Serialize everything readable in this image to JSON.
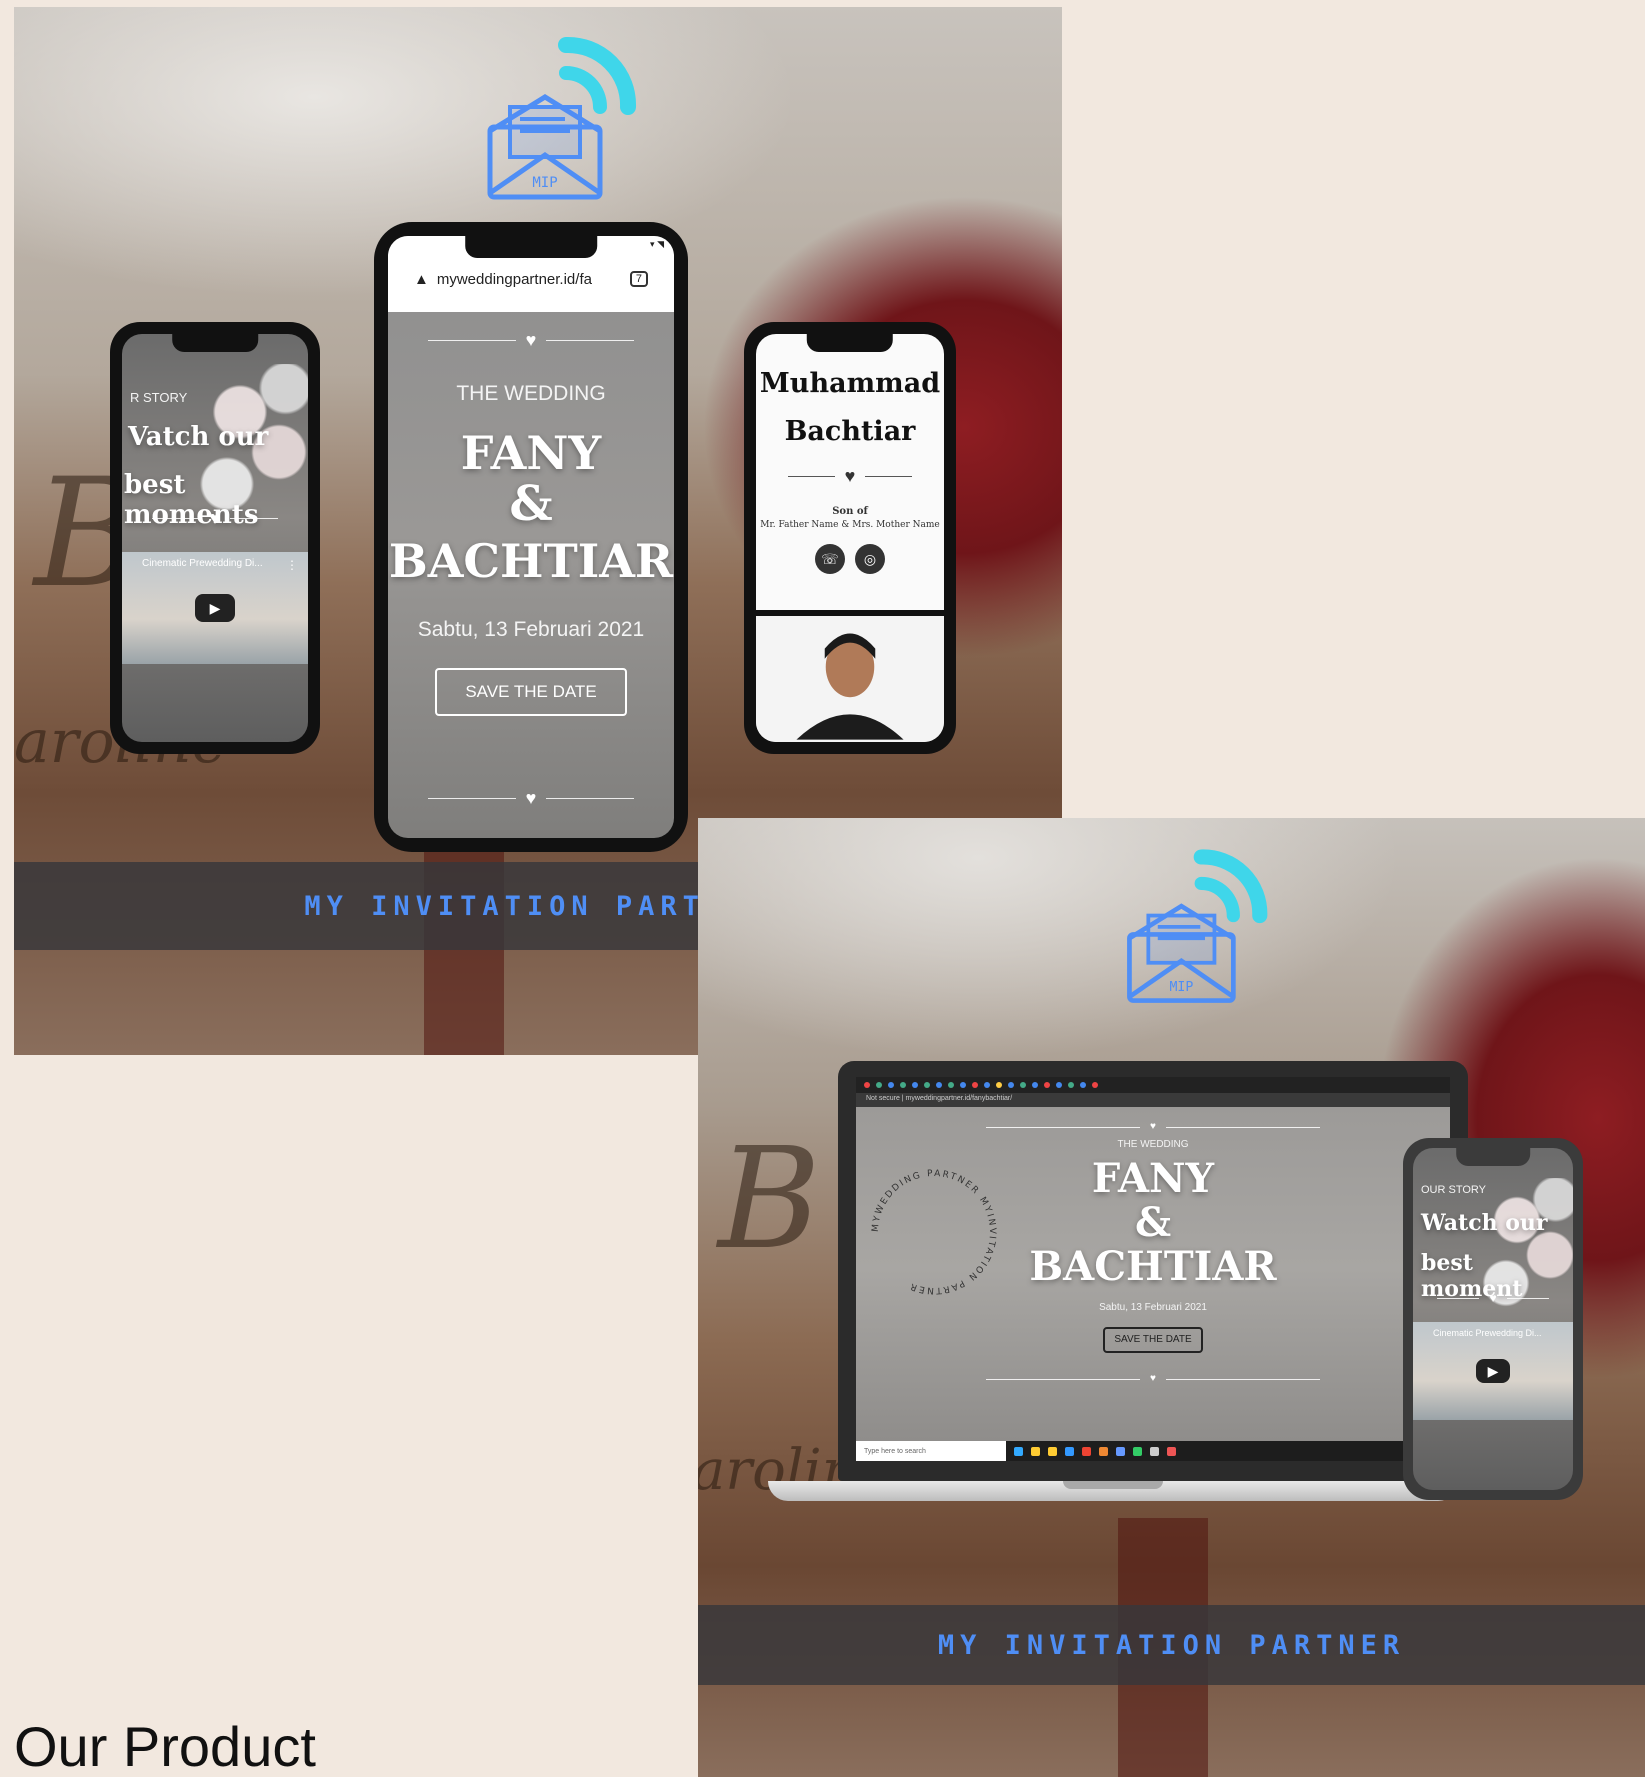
{
  "brand": {
    "banner_text": "MY INVITATION PARTNER",
    "logo_label": "MIP",
    "accent_color": "#4f8ef5",
    "signal_color": "#3fd6ea"
  },
  "promo1": {
    "center_phone": {
      "url": "myweddingpartner.id/fa",
      "tab_count": "7",
      "the_wedding": "THE WEDDING",
      "name1": "FANY",
      "amp": "&",
      "name2": "BACHTIAR",
      "date": "Sabtu, 13 Februari 2021",
      "save_btn": "SAVE THE DATE"
    },
    "left_phone": {
      "section": "R STORY",
      "heading_line1": "Vatch our",
      "heading_line2": "best moments",
      "video_title": "Cinematic Prewedding Di..."
    },
    "right_phone": {
      "name_line1": "Muhammad",
      "name_line2": "Bachtiar",
      "son_of": "Son of",
      "parents": "Mr. Father Name & Mrs. Mother Name"
    }
  },
  "promo2": {
    "laptop": {
      "address": "Not secure | myweddingpartner.id/fanybachtiar/",
      "the_wedding": "THE WEDDING",
      "name1": "FANY",
      "amp": "&",
      "name2": "BACHTIAR",
      "date": "Sabtu, 13 Februari 2021",
      "save_btn": "SAVE THE DATE",
      "circle_text": "MYWEDDING PARTNER MYINVITATION PARTNER",
      "taskbar_search": "Type here to search"
    },
    "phone": {
      "section": "OUR STORY",
      "heading_line1": "Watch our",
      "heading_line2": "best moment",
      "video_title": "Cinematic Prewedding Di..."
    }
  },
  "page": {
    "section_title": "Our Product"
  }
}
